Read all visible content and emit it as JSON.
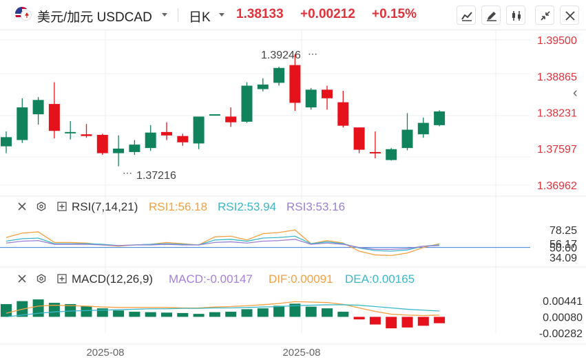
{
  "header": {
    "symbol_cn": "美元/加元",
    "symbol_code": "USDCAD",
    "period": "日K",
    "price": "1.38133",
    "change": "+0.00212",
    "change_pct": "+0.15%"
  },
  "toolbar": {
    "icons": [
      "line-chart-icon",
      "draw-icon",
      "candlestick-icon",
      "shrink-icon",
      "close-icon"
    ]
  },
  "main_chart": {
    "y_ticks": [
      "1.39500",
      "1.38865",
      "1.38231",
      "1.37597",
      "1.36962"
    ],
    "high_label": "1.39246",
    "low_label": "1.37216",
    "candles": [
      {
        "o": 1.3764,
        "h": 1.379,
        "l": 1.3752,
        "c": 1.378
      },
      {
        "o": 1.3775,
        "h": 1.3848,
        "l": 1.377,
        "c": 1.3832
      },
      {
        "o": 1.382,
        "h": 1.385,
        "l": 1.3802,
        "c": 1.3845
      },
      {
        "o": 1.3838,
        "h": 1.3876,
        "l": 1.3778,
        "c": 1.3791
      },
      {
        "o": 1.3789,
        "h": 1.3808,
        "l": 1.3776,
        "c": 1.3789
      },
      {
        "o": 1.3785,
        "h": 1.3803,
        "l": 1.3779,
        "c": 1.3782
      },
      {
        "o": 1.3784,
        "h": 1.3786,
        "l": 1.3749,
        "c": 1.3752
      },
      {
        "o": 1.3752,
        "h": 1.3783,
        "l": 1.3729,
        "c": 1.376
      },
      {
        "o": 1.3754,
        "h": 1.3775,
        "l": 1.3749,
        "c": 1.3767
      },
      {
        "o": 1.3761,
        "h": 1.3801,
        "l": 1.3756,
        "c": 1.3788
      },
      {
        "o": 1.3789,
        "h": 1.3806,
        "l": 1.3775,
        "c": 1.3783
      },
      {
        "o": 1.3782,
        "h": 1.3786,
        "l": 1.3765,
        "c": 1.3771
      },
      {
        "o": 1.3769,
        "h": 1.3815,
        "l": 1.3759,
        "c": 1.3816
      },
      {
        "o": 1.3818,
        "h": 1.382,
        "l": 1.3818,
        "c": 1.382
      },
      {
        "o": 1.3816,
        "h": 1.3832,
        "l": 1.3798,
        "c": 1.3806
      },
      {
        "o": 1.3807,
        "h": 1.3876,
        "l": 1.3805,
        "c": 1.387
      },
      {
        "o": 1.3864,
        "h": 1.3883,
        "l": 1.386,
        "c": 1.3872
      },
      {
        "o": 1.3875,
        "h": 1.3903,
        "l": 1.387,
        "c": 1.3901
      },
      {
        "o": 1.3906,
        "h": 1.3925,
        "l": 1.3826,
        "c": 1.384
      },
      {
        "o": 1.3832,
        "h": 1.3866,
        "l": 1.3828,
        "c": 1.3863
      },
      {
        "o": 1.3863,
        "h": 1.387,
        "l": 1.3828,
        "c": 1.3848
      },
      {
        "o": 1.3841,
        "h": 1.3861,
        "l": 1.3797,
        "c": 1.38
      },
      {
        "o": 1.3797,
        "h": 1.3797,
        "l": 1.3752,
        "c": 1.3758
      },
      {
        "o": 1.3754,
        "h": 1.379,
        "l": 1.3743,
        "c": 1.3753
      },
      {
        "o": 1.374,
        "h": 1.3761,
        "l": 1.3739,
        "c": 1.3759
      },
      {
        "o": 1.3761,
        "h": 1.3822,
        "l": 1.3757,
        "c": 1.3793
      },
      {
        "o": 1.3785,
        "h": 1.3814,
        "l": 1.3779,
        "c": 1.3805
      },
      {
        "o": 1.3801,
        "h": 1.3827,
        "l": 1.3799,
        "c": 1.3825
      }
    ]
  },
  "rsi": {
    "title": "RSI(7,14,21)",
    "rsi1": "RSI1:56.18",
    "rsi2": "RSI2:53.94",
    "rsi3": "RSI3:53.16",
    "y_ticks": [
      "78.25",
      "56.17",
      "50.00",
      "34.09"
    ],
    "colors": {
      "rsi1": "#f5a040",
      "rsi2": "#3ab7c9",
      "rsi3": "#9b7fd4"
    }
  },
  "macd": {
    "title": "MACD(12,26,9)",
    "macd_label": "MACD:-0.00147",
    "dif_label": "DIF:0.00091",
    "dea_label": "DEA:0.00165",
    "y_ticks": [
      "0.00441",
      "0.00080",
      "-0.00282"
    ],
    "colors": {
      "macd": "#a77fd8",
      "dif": "#f5a040",
      "dea": "#3ab7c9"
    }
  },
  "x_axis": {
    "labels": [
      "2025-08",
      "2025-08"
    ]
  },
  "colors": {
    "up": "#11835c",
    "down": "#e5121b",
    "accent": "#e0323a"
  }
}
